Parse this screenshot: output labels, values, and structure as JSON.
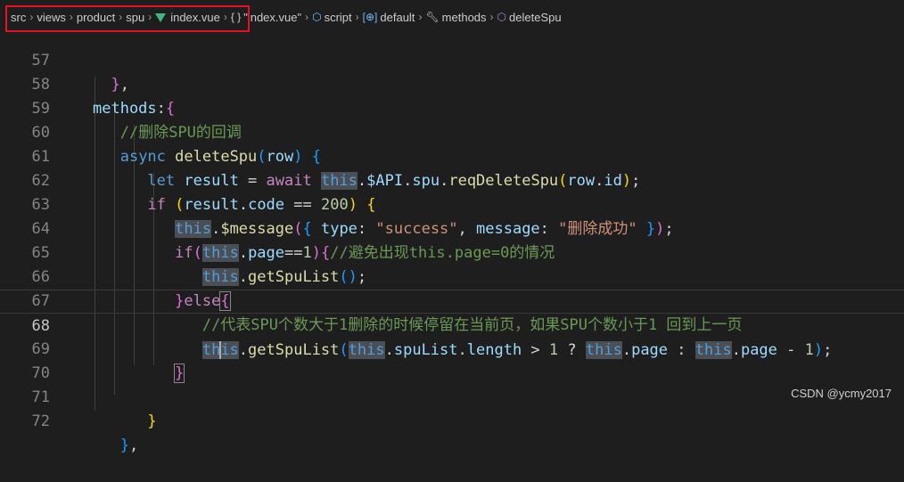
{
  "breadcrumb": {
    "path": [
      "src",
      "views",
      "product",
      "spu"
    ],
    "file": "index.vue",
    "symbols": [
      {
        "icon": "braces-icon",
        "label": "\"index.vue\""
      },
      {
        "icon": "cube-icon",
        "label": "script"
      },
      {
        "icon": "brackets-icon",
        "label": "default"
      },
      {
        "icon": "wrench-icon",
        "label": "methods"
      },
      {
        "icon": "cube-icon",
        "label": "deleteSpu"
      }
    ]
  },
  "editor": {
    "current_line": 68,
    "line_numbers": [
      "57",
      "58",
      "59",
      "60",
      "61",
      "62",
      "63",
      "64",
      "65",
      "66",
      "67",
      "68",
      "69",
      "70",
      "71",
      "72"
    ],
    "comments": {
      "l59": "//删除SPU的回调",
      "l64": "//避免出现this.page=0的情况",
      "l67": "//代表SPU个数大于1删除的时候停留在当前页，如果SPU个数小于1 回到上一页"
    },
    "strings": {
      "success": "\"success\"",
      "message": "\"删除成功\""
    },
    "numbers": {
      "code": "200",
      "one": "1"
    }
  },
  "watermark": "CSDN @ycmy2017",
  "colors": {
    "background": "#1e1e1e",
    "keyword": "#569cd6",
    "control": "#c586c0",
    "function": "#dcdcaa",
    "variable": "#9cdcfe",
    "string": "#ce9178",
    "comment": "#6a9955",
    "highlight_box": "#e81123"
  }
}
